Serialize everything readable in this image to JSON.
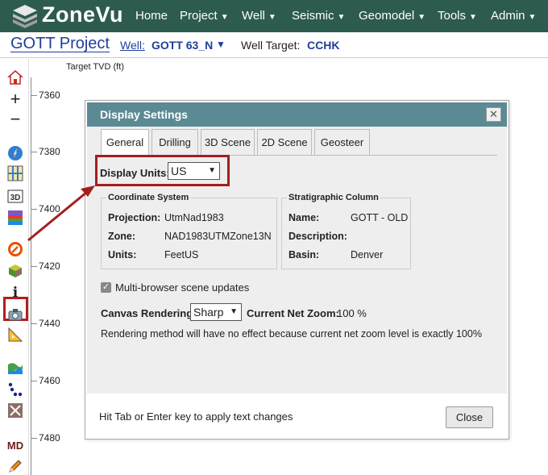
{
  "app": {
    "logo_text": "ZoneVu",
    "nav": [
      {
        "label": "Home",
        "caret": false
      },
      {
        "label": "Project",
        "caret": true
      },
      {
        "label": "Well",
        "caret": true
      },
      {
        "label": "Seismic",
        "caret": true
      },
      {
        "label": "Geomodel",
        "caret": true
      },
      {
        "label": "Tools",
        "caret": true
      },
      {
        "label": "Admin",
        "caret": true
      }
    ]
  },
  "header": {
    "project_title": "GOTT Project",
    "well_label": "Well:",
    "well_name": "GOTT 63_N",
    "target_label": "Well Target:",
    "target_value": "CCHK"
  },
  "axis": {
    "title": "Target TVD (ft)",
    "ticks": [
      "7360",
      "7380",
      "7400",
      "7420",
      "7440",
      "7460",
      "7480"
    ]
  },
  "dialog": {
    "title": "Display Settings",
    "close_glyph": "✕",
    "tabs": [
      "General",
      "Drilling",
      "3D Scene",
      "2D Scene",
      "Geosteer"
    ],
    "active_tab": "General",
    "display_units_label": "Display Units:",
    "display_units_value": "US",
    "coordinate_system": {
      "legend": "Coordinate System",
      "projection_label": "Projection:",
      "projection_value": "UtmNad1983",
      "zone_label": "Zone:",
      "zone_value": "NAD1983UTMZone13N",
      "units_label": "Units:",
      "units_value": "FeetUS"
    },
    "stratigraphic_column": {
      "legend": "Stratigraphic Column",
      "name_label": "Name:",
      "name_value": "GOTT - OLD",
      "description_label": "Description:",
      "description_value": "",
      "basin_label": "Basin:",
      "basin_value": "Denver"
    },
    "multi_browser_label": "Multi-browser scene updates",
    "multi_browser_checked": true,
    "canvas_rendering_label": "Canvas Rendering:",
    "canvas_rendering_value": "Sharp",
    "net_zoom_label": "Current Net Zoom:",
    "net_zoom_value": "100 %",
    "render_note": "Rendering method will have no effect because current net zoom level is exactly 100%",
    "footer_hint": "Hit Tab or Enter key to apply text changes",
    "close_button": "Close"
  },
  "toolbar_icons": [
    "home-icon",
    "zoom-in-icon",
    "zoom-out-icon",
    "compass-icon",
    "grid-icon",
    "3d-icon",
    "section-icon",
    "display-settings-icon",
    "cube-icon",
    "info-icon",
    "camera-icon",
    "ruler-icon",
    "surface-icon",
    "points-icon",
    "fault-icon",
    "md-icon",
    "pencil-icon"
  ],
  "colors": {
    "nav_bg": "#2d5b50",
    "dialog_title_bg": "#5c8a94",
    "link_blue": "#1f3f9a",
    "highlight_red": "#a51e1e"
  }
}
